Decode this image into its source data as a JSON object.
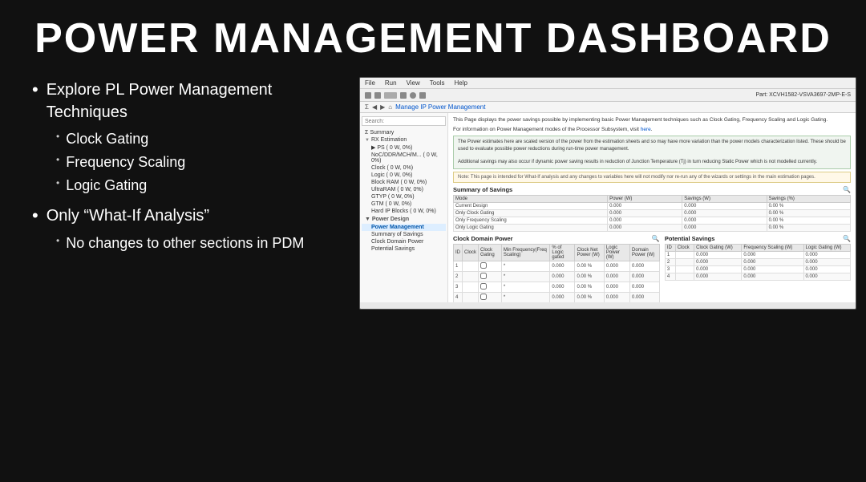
{
  "title": "POWER MANAGEMENT DASHBOARD",
  "bullets": [
    {
      "text": "Explore PL Power Management Techniques",
      "sub": [
        "Clock Gating",
        "Frequency Scaling",
        "Logic Gating"
      ]
    },
    {
      "text": "Only “What-If Analysis”",
      "sub": [
        "No changes to other sections in PDM"
      ]
    }
  ],
  "app": {
    "part_label": "Part: XCVH1582-VSVA3697-2MP-E-S",
    "menubar": [
      "File",
      "Run",
      "View",
      "Tools",
      "Help"
    ],
    "nav_breadcrumb": "Manage IP  Power Management",
    "sidebar_search": "Search:",
    "sidebar_items": [
      {
        "label": "Summary",
        "icon": "Σ"
      },
      {
        "label": "RX Estimation",
        "sub": [
          {
            "label": "PS ( 0 W, 0%)",
            "expanded": true
          },
          {
            "label": "NoC/DDR/MCH/M... ( 0 W, 0%)"
          },
          {
            "label": "Clock ( 0 W, 0%)"
          },
          {
            "label": "Logic ( 0 W, 0%)"
          },
          {
            "label": "Block RAM ( 0 W, 0%)"
          },
          {
            "label": "UltraRAM ( 0 W, 0%)"
          },
          {
            "label": "GTYP ( 0 W, 0%)"
          },
          {
            "label": "GTM ( 0 W, 0%)"
          },
          {
            "label": "Hard IP Blocks ( 0 W, 0%)"
          }
        ]
      },
      {
        "label": "Power Design",
        "sub": [
          {
            "label": "Power Management",
            "active": true
          },
          {
            "label": "Summary of Savings"
          },
          {
            "label": "Clock Domain Power"
          },
          {
            "label": "Potential Savings"
          }
        ]
      }
    ],
    "info_text1": "This Page displays the power savings possible by implementing basic Power Management techniques such as Clock Gating, Frequency Scaling and Logic Gating.",
    "info_text2": "For information on Power Management modes of the Processor Subsystem, visit here.",
    "info_box_text": "The Power estimates here are scaled version of the power from the estimation sheets and so may have more variation than the power models characterization listed. These should be used to evaluate possible power reductions during run-time power management.\n\nAdditional savings may also occur if dynamic power saving results in reduction of Junction Temperature (Tj) in turn reducing Static Power which is not modelled currently.",
    "note_text": "Note: This page is intended for What-If analysis and any changes to variables here will not modify nor re-run any of the wizards or settings in the main estimation pages.",
    "summary_title": "Summary of Savings",
    "summary_columns": [
      "Mode",
      "Power (W)",
      "Savings (W)",
      "Savings (%)"
    ],
    "summary_rows": [
      [
        "Current Design",
        "0.000",
        "0.000",
        "0.00 %"
      ],
      [
        "Only Clock Gating",
        "0.000",
        "0.000",
        "0.00 %"
      ],
      [
        "Only Frequency Scaling",
        "0.000",
        "0.000",
        "0.00 %"
      ],
      [
        "Only Logic Gating",
        "0.000",
        "0.000",
        "0.00 %"
      ]
    ],
    "clock_domain_title": "Clock Domain Power",
    "clock_domain_columns": [
      "ID",
      "Clock",
      "Clock Gating",
      "Min Frequency(Freq Scaling)",
      "% of Logic gated",
      "Clock Net Power (W)",
      "Logic Power (W)",
      "Domain Power (W)"
    ],
    "clock_domain_rows": [
      [
        "1",
        "",
        "0",
        "*",
        "0.000",
        "0.00 %",
        "0.000",
        "0.000",
        "0.000"
      ],
      [
        "2",
        "",
        "0",
        "*",
        "0.000",
        "0.00 %",
        "0.000",
        "0.000",
        "0.000"
      ],
      [
        "3",
        "",
        "0",
        "*",
        "0.000",
        "0.00 %",
        "0.000",
        "0.000",
        "0.000"
      ],
      [
        "4",
        "",
        "0",
        "*",
        "0.000",
        "0.00 %",
        "0.000",
        "0.000",
        "0.000"
      ]
    ],
    "potential_savings_title": "Potential Savings",
    "potential_savings_columns": [
      "ID",
      "Clock",
      "Clock Gating (W)",
      "Frequency Scaling (W)",
      "Logic Gating (W)"
    ],
    "potential_savings_rows": [
      [
        "1",
        "",
        "0.000",
        "0.000",
        "0.000"
      ],
      [
        "2",
        "",
        "0.000",
        "0.000",
        "0.000"
      ],
      [
        "3",
        "",
        "0.000",
        "0.000",
        "0.000"
      ],
      [
        "4",
        "",
        "0.000",
        "0.000",
        "0.000"
      ]
    ]
  }
}
